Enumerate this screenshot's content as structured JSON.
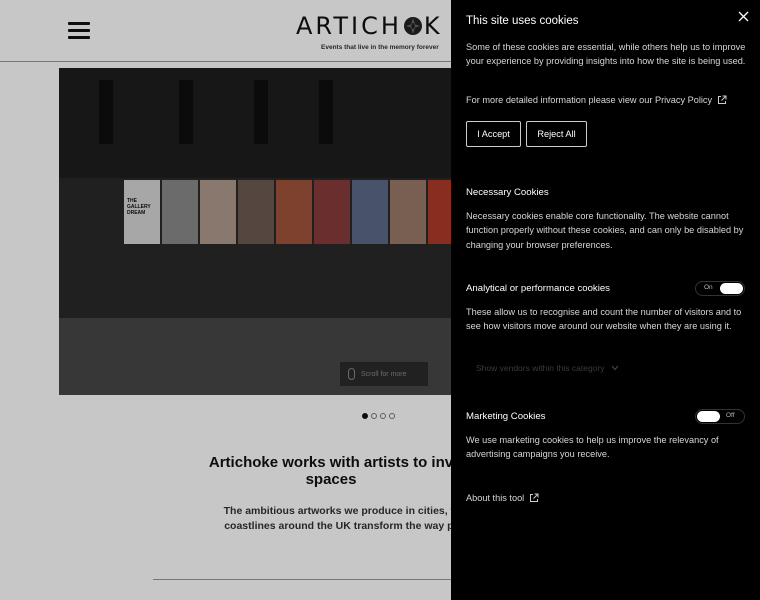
{
  "site": {
    "logo_text": "ARTICH",
    "logo_text_tail": "K",
    "tagline": "Events that live in the memory forever",
    "hero": {
      "gallery_label": "THE GALLERY DREAM",
      "scroll_label": "Scroll for more"
    },
    "carousel": {
      "count": 4,
      "active": 1
    },
    "intro_heading": "Artichoke works with artists to inv spaces",
    "intro_body": "The ambitious artworks we produce in cities, the coastlines around the UK transform the way peo"
  },
  "cookie_panel": {
    "title": "This site uses cookies",
    "intro": "Some of these cookies are essential, while others help us to improve your experience by providing insights into how the site is being used.",
    "privacy_link": "For more detailed information please view our Privacy Policy",
    "accept_label": "I Accept",
    "reject_label": "Reject All",
    "necessary": {
      "title": "Necessary Cookies",
      "description": "Necessary cookies enable core functionality. The website cannot function properly without these cookies, and can only be disabled by changing your browser preferences."
    },
    "analytical": {
      "title": "Analytical or performance cookies",
      "toggle_label": "On",
      "enabled": true,
      "description": "These allow us to recognise and count the number of visitors and to see how visitors move around our website when they are using it.",
      "vendors_label": "Show vendors within this category"
    },
    "marketing": {
      "title": "Marketing Cookies",
      "toggle_label": "Off",
      "enabled": false,
      "description": "We use marketing cookies to help us improve the relevancy of advertising campaigns you receive."
    },
    "about_link": "About this tool"
  },
  "icons": {
    "menu": "hamburger-icon",
    "close": "close-icon",
    "external": "external-link-icon",
    "chevron": "chevron-down-icon",
    "mouse": "mouse-icon"
  },
  "colors": {
    "panel_bg": "#000000",
    "panel_text": "#ffffff"
  }
}
